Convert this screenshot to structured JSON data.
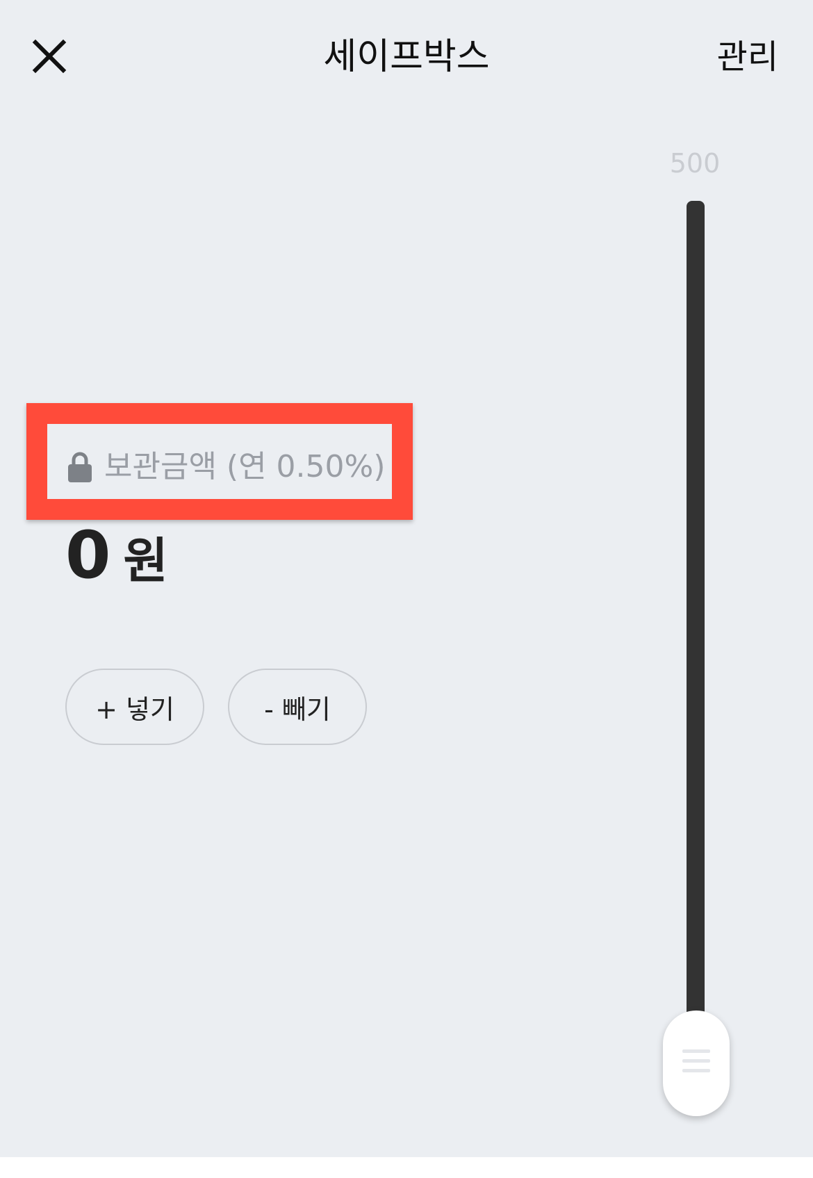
{
  "header": {
    "title": "세이프박스",
    "manage_label": "관리",
    "close_icon": "close-icon"
  },
  "balance": {
    "lock_icon": "lock-icon",
    "label": "보관금액 (연 0.50%)",
    "amount": "0",
    "unit": "원"
  },
  "actions": {
    "deposit_label": "+ 넣기",
    "withdraw_label": "- 빼기"
  },
  "slider": {
    "max_label": "500",
    "value": 0
  },
  "colors": {
    "background": "#ebeef2",
    "highlight": "#ff4b3a",
    "track": "#333333",
    "text_muted": "#9a9ea5"
  }
}
